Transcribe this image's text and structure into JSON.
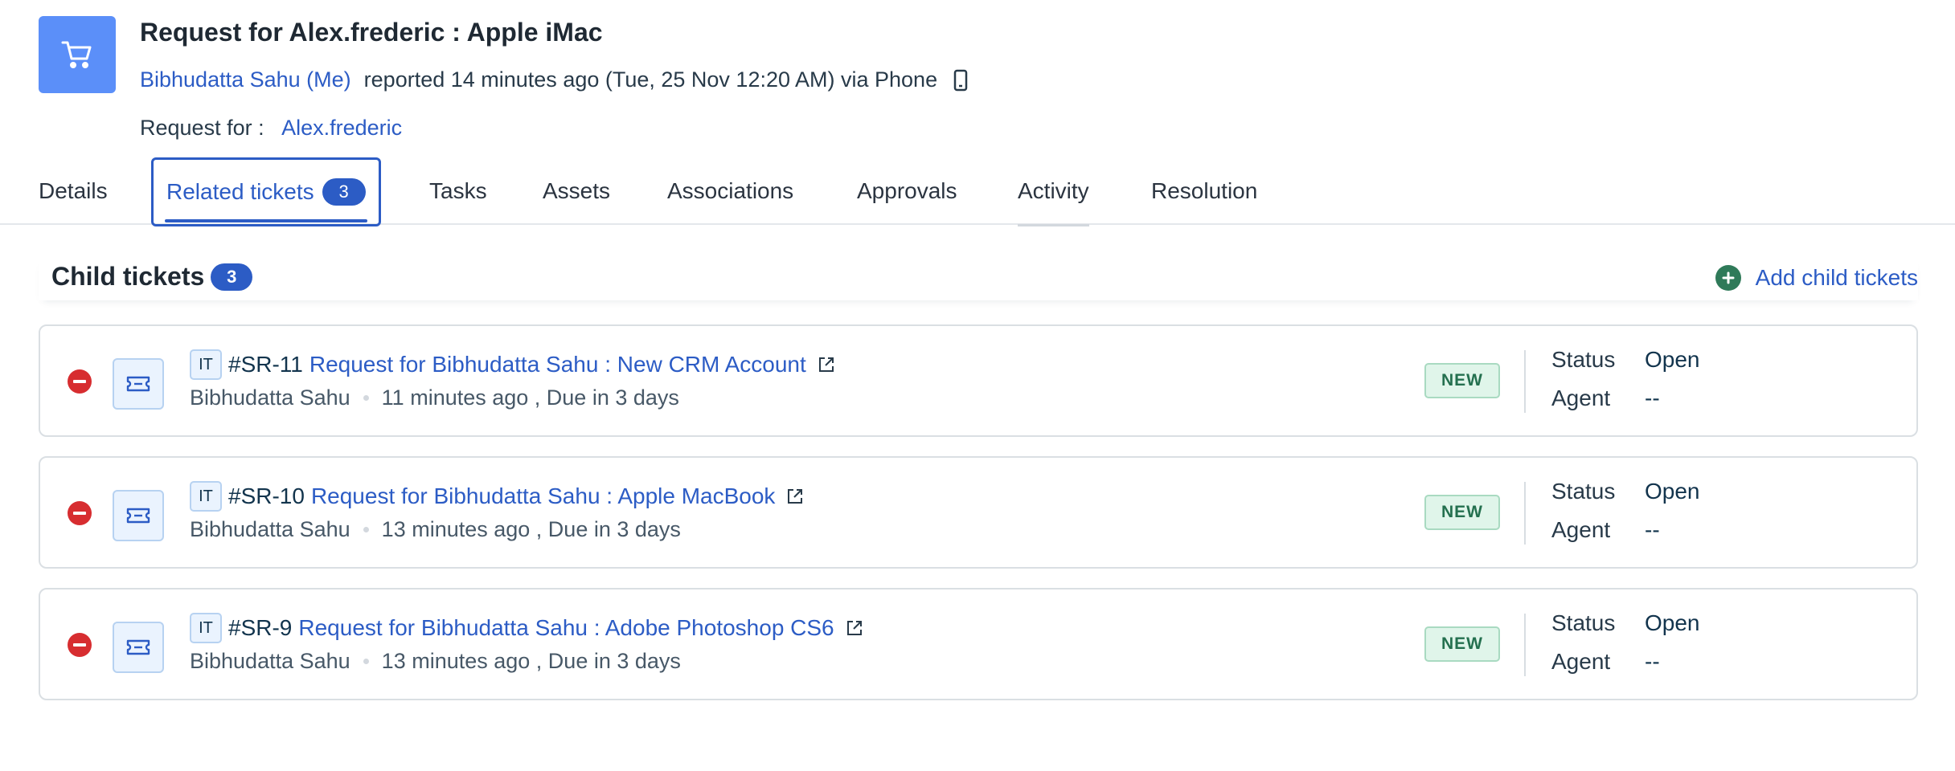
{
  "header": {
    "title": "Request for Alex.frederic : Apple iMac",
    "reporter": "Bibhudatta Sahu (Me)",
    "reported_text": "reported 14 minutes ago (Tue, 25 Nov 12:20 AM) via Phone",
    "request_for_label": "Request for :",
    "request_for_value": "Alex.frederic"
  },
  "tabs": [
    {
      "label": "Details"
    },
    {
      "label": "Related tickets",
      "count": "3"
    },
    {
      "label": "Tasks"
    },
    {
      "label": "Assets"
    },
    {
      "label": "Associations"
    },
    {
      "label": "Approvals"
    },
    {
      "label": "Activity"
    },
    {
      "label": "Resolution"
    }
  ],
  "section": {
    "title": "Child tickets",
    "count": "3",
    "add_label": "Add child tickets"
  },
  "tickets": [
    {
      "workspace": "IT",
      "id": "#SR-11",
      "subject": "Request for Bibhudatta Sahu : New CRM Account",
      "requester": "Bibhudatta Sahu",
      "time": "11 minutes ago , Due in 3 days",
      "badge": "NEW",
      "status_label": "Status",
      "status": "Open",
      "agent_label": "Agent",
      "agent": "--"
    },
    {
      "workspace": "IT",
      "id": "#SR-10",
      "subject": "Request for Bibhudatta Sahu : Apple MacBook",
      "requester": "Bibhudatta Sahu",
      "time": "13 minutes ago , Due in 3 days",
      "badge": "NEW",
      "status_label": "Status",
      "status": "Open",
      "agent_label": "Agent",
      "agent": "--"
    },
    {
      "workspace": "IT",
      "id": "#SR-9",
      "subject": "Request for Bibhudatta Sahu : Adobe Photoshop CS6",
      "requester": "Bibhudatta Sahu",
      "time": "13 minutes ago , Due in 3 days",
      "badge": "NEW",
      "status_label": "Status",
      "status": "Open",
      "agent_label": "Agent",
      "agent": "--"
    }
  ],
  "icons": {
    "header": "shopping-cart-icon",
    "device": "mobile-phone-icon",
    "add": "plus-circle-icon",
    "remove": "minus-circle-icon",
    "ticket": "ticket-icon",
    "external": "external-link-icon"
  },
  "colors": {
    "accent": "#2c5cc5",
    "header_icon_bg": "#5b8ff9",
    "add_icon": "#2f7a59",
    "remove_icon": "#d72d30",
    "new_badge_bg": "#e0f5ea",
    "new_badge_text": "#24704f"
  }
}
